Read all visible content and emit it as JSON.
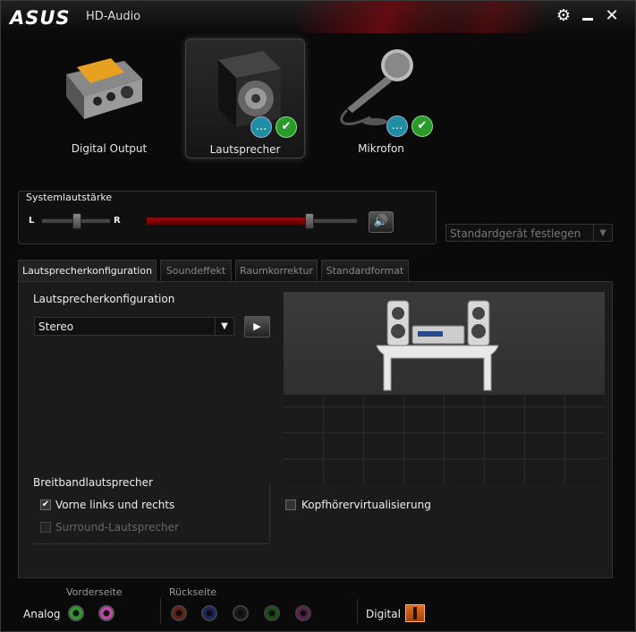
{
  "titlebar": {
    "logo": "ASUS",
    "title": "HD-Audio",
    "settings_icon": "gear-icon",
    "minimize_icon": "minimize-icon",
    "close_icon": "close-icon"
  },
  "devices": [
    {
      "label": "Digital Output",
      "selected": false
    },
    {
      "label": "Lautsprecher",
      "selected": true
    },
    {
      "label": "Mikrofon",
      "selected": false
    }
  ],
  "volume": {
    "title": "Systemlautstärke",
    "left_label": "L",
    "right_label": "R",
    "balance": 0.5,
    "level": 0.77,
    "mute_icon": "speaker-icon"
  },
  "default_device": {
    "label": "Standardgerät festlegen"
  },
  "tabs": [
    "Lautsprecherkonfiguration",
    "Soundeffekt",
    "Raumkorrektur",
    "Standardformat"
  ],
  "active_tab": 0,
  "config": {
    "heading": "Lautsprecherkonfiguration",
    "selected": "Stereo",
    "play_icon": "play-icon"
  },
  "fullrange": {
    "title": "Breitbandlautsprecher",
    "front": {
      "label": "Vorne links und rechts",
      "checked": true
    },
    "surround": {
      "label": "Surround-Lautsprecher",
      "checked": false,
      "disabled": true
    }
  },
  "headphone": {
    "label": "Kopfhörervirtualisierung",
    "checked": false
  },
  "bottom": {
    "analog": "Analog",
    "front_label": "Vorderseite",
    "back_label": "Rückseite",
    "digital": "Digital",
    "front_jacks": [
      "#2e9a2e",
      "#c24aa8"
    ],
    "back_jacks": [
      "#8a2a1a",
      "#1f2f8a",
      "#222222",
      "#1f6a1f",
      "#7a2a6a"
    ]
  }
}
